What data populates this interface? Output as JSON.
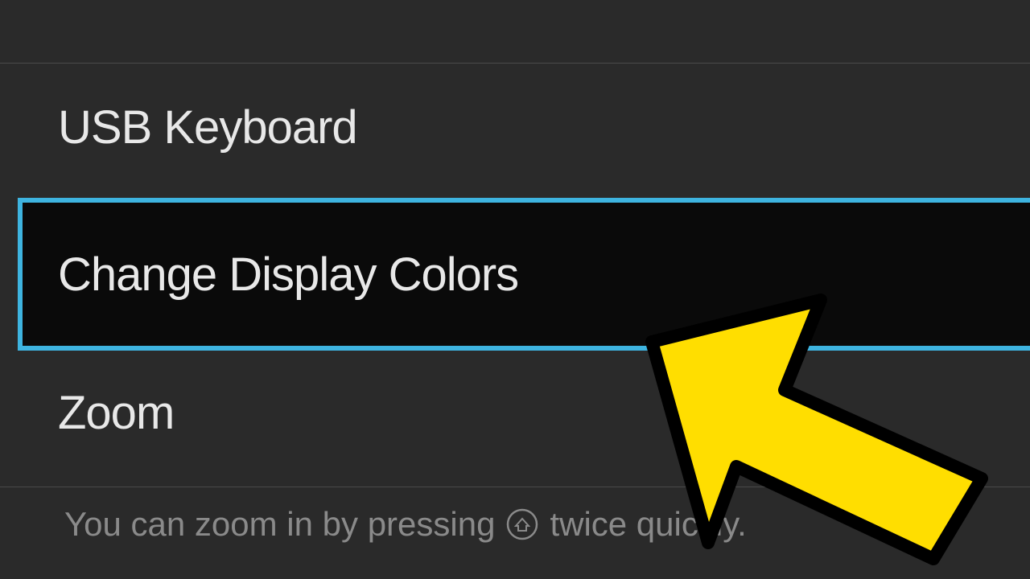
{
  "menu": {
    "items": [
      {
        "label": "USB Keyboard"
      },
      {
        "label": "Change Display Colors"
      },
      {
        "label": "Zoom"
      }
    ]
  },
  "hint": {
    "before": "You can zoom in by pressing",
    "after": "twice quickly."
  },
  "colors": {
    "selectedBorder": "#3eb4e0",
    "background": "#2a2a2a",
    "selectedBackground": "#0a0a0a",
    "arrowFill": "#ffde00"
  }
}
